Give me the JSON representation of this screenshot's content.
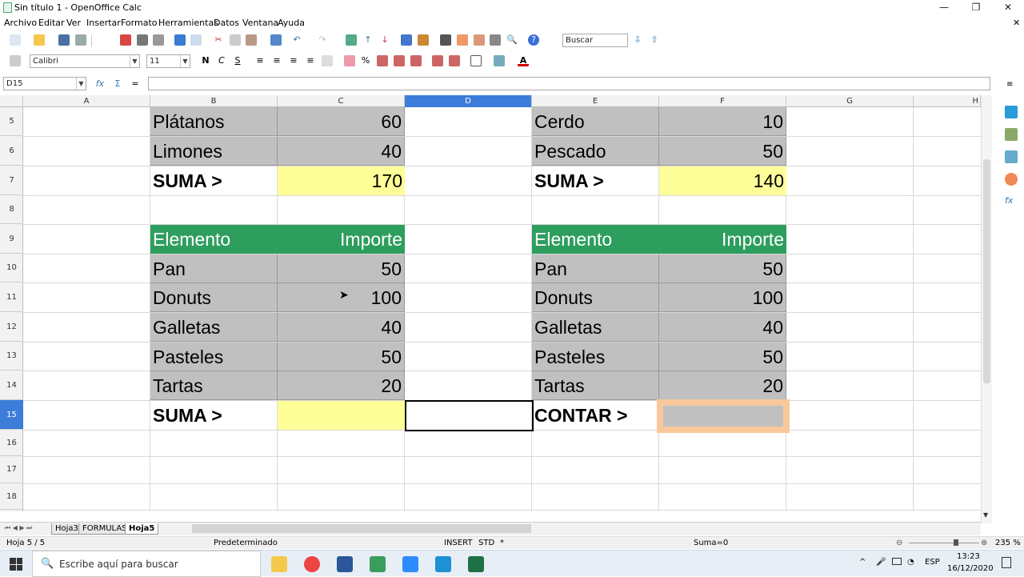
{
  "window": {
    "title": "Sin título 1 - OpenOffice Calc",
    "min": "—",
    "max": "❐",
    "close": "✕"
  },
  "menu": [
    "Archivo",
    "Editar",
    "Ver",
    "Insertar",
    "Formato",
    "Herramientas",
    "Datos",
    "Ventana",
    "Ayuda"
  ],
  "toolbar": {
    "search_placeholder": "Buscar",
    "font_name": "Calibri",
    "font_size": "11",
    "bold": "N",
    "italic": "C",
    "underline": "S"
  },
  "formula_bar": {
    "name_box": "D15",
    "value": ""
  },
  "columns": [
    "A",
    "B",
    "C",
    "D",
    "E",
    "F",
    "G",
    "H"
  ],
  "rows": [
    "5",
    "6",
    "7",
    "8",
    "9",
    "10",
    "11",
    "12",
    "13",
    "14",
    "15",
    "16",
    "17",
    "18"
  ],
  "selected_cell": "D15",
  "table_left": {
    "top_rows": [
      [
        "Plátanos",
        "60"
      ],
      [
        "Limones",
        "40"
      ]
    ],
    "top_sum_label": "SUMA >",
    "top_sum_value": "170",
    "header": [
      "Elemento",
      "Importe"
    ],
    "rows": [
      [
        "Pan",
        "50"
      ],
      [
        "Donuts",
        "100"
      ],
      [
        "Galletas",
        "40"
      ],
      [
        "Pasteles",
        "50"
      ],
      [
        "Tartas",
        "20"
      ]
    ],
    "sum_label": "SUMA >",
    "sum_value": ""
  },
  "table_right": {
    "top_rows": [
      [
        "Cerdo",
        "10"
      ],
      [
        "Pescado",
        "50"
      ]
    ],
    "top_sum_label": "SUMA >",
    "top_sum_value": "140",
    "header": [
      "Elemento",
      "Importe"
    ],
    "rows": [
      [
        "Pan",
        "50"
      ],
      [
        "Donuts",
        "100"
      ],
      [
        "Galletas",
        "40"
      ],
      [
        "Pasteles",
        "50"
      ],
      [
        "Tartas",
        "20"
      ]
    ],
    "count_label": "CONTAR >",
    "count_value": ""
  },
  "sheets": [
    "Hoja3",
    "FORMULAS",
    "Hoja5"
  ],
  "active_sheet": "Hoja5",
  "status": {
    "sheet": "Hoja 5 / 5",
    "style": "Predeterminado",
    "mode": "INSERT",
    "sel": "STD",
    "asterisk": "*",
    "sum": "Suma=0",
    "zoom": "235 %"
  },
  "taskbar": {
    "search_placeholder": "Escribe aquí para buscar",
    "time": "13:23",
    "date": "16/12/2020",
    "lang": "ESP"
  },
  "colors": {
    "green": "#2e9e5e",
    "gray": "#c0c0c0",
    "yellow": "#ffff99",
    "selection": "#3b7dd8",
    "highlight": "#f9c89b"
  }
}
